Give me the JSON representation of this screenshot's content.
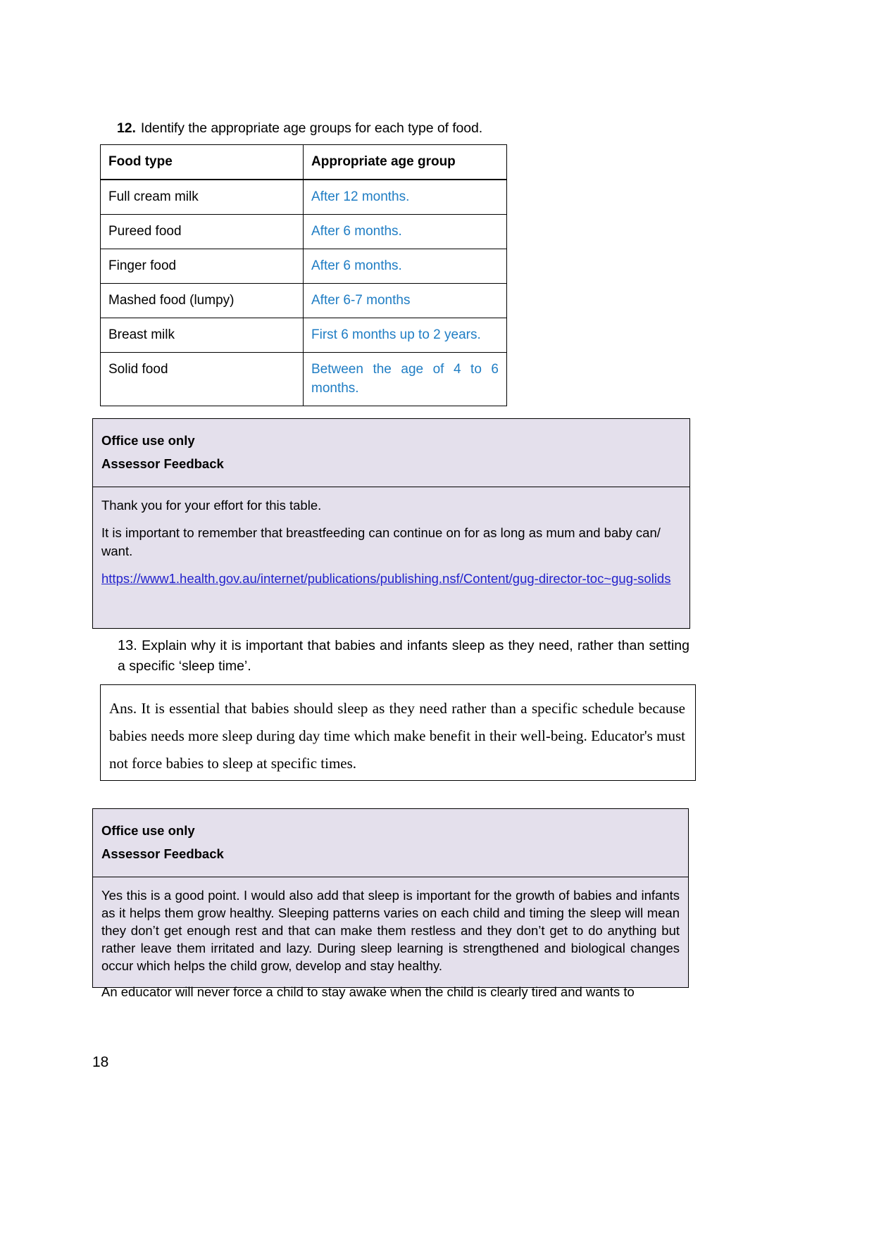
{
  "question_12": {
    "number": "12.",
    "text": "Identify the appropriate age groups for each type of food.",
    "table": {
      "headers": [
        "Food type",
        "Appropriate age group"
      ],
      "rows": [
        {
          "food_type": "Full cream milk",
          "age_group": "After 12 months."
        },
        {
          "food_type": "Pureed food",
          "age_group": "After 6 months."
        },
        {
          "food_type": "Finger food",
          "age_group": "After 6 months."
        },
        {
          "food_type": "Mashed food (lumpy)",
          "age_group": "After 6-7 months"
        },
        {
          "food_type": "Breast milk",
          "age_group": "First 6 months up to 2 years."
        },
        {
          "food_type": "Solid food",
          "age_group": "Between the age of 4 to 6 months."
        }
      ]
    }
  },
  "feedback_1": {
    "title": "Office use only",
    "subtitle": "Assessor Feedback",
    "paragraph_1": "Thank you for your effort for this table.",
    "paragraph_2": "It is important to remember that breastfeeding can continue on for as long as mum and baby can/ want.",
    "url": "https://www1.health.gov.au/internet/publications/publishing.nsf/Content/gug-director-toc~gug-solids"
  },
  "question_13": {
    "number": "13.",
    "text": "Explain why it is important that babies and infants sleep as they need, rather than setting a specific ‘sleep time’.",
    "answer": "Ans. It is essential that babies should sleep as they need rather than a specific schedule because babies needs more sleep during day time which make benefit in their well-being. Educator's must not force babies to sleep at specific times."
  },
  "feedback_2": {
    "title": "Office use only",
    "subtitle": "Assessor Feedback",
    "paragraph_1": "Yes this is a good point. I would also add that sleep is important for the growth of babies and infants as it helps them grow healthy. Sleeping patterns varies on each child and timing the sleep will mean they don’t get enough rest and that can make them restless and they don’t get to do anything but rather leave them irritated and lazy. During sleep learning is strengthened and biological changes occur which helps the child grow, develop and stay healthy.",
    "paragraph_2": "An educator will never force a child to stay awake when the child is clearly tired and wants to"
  },
  "footer": {
    "page_number": "18"
  },
  "colors": {
    "answer_blue": "#1F7DC4",
    "link_blue": "#2222CC",
    "feedback_background": "#E4E0EC"
  }
}
